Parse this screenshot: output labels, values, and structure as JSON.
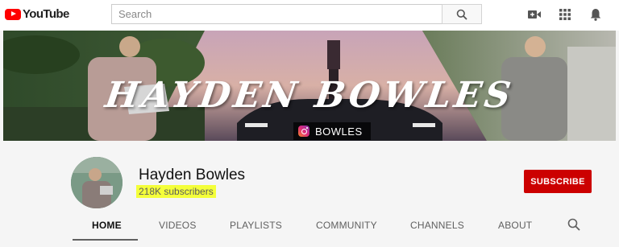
{
  "topbar": {
    "logo_text": "YouTube",
    "search_placeholder": "Search",
    "icons": [
      "create-video-icon",
      "apps-grid-icon",
      "notifications-bell-icon"
    ]
  },
  "banner": {
    "title": "HAYDEN BOWLES",
    "handle": "BOWLES",
    "handle_icon": "instagram-icon"
  },
  "channel": {
    "name": "Hayden Bowles",
    "subscribers": "218K subscribers",
    "subscribe_label": "SUBSCRIBE"
  },
  "tabs": [
    {
      "label": "HOME",
      "active": true
    },
    {
      "label": "VIDEOS"
    },
    {
      "label": "PLAYLISTS"
    },
    {
      "label": "COMMUNITY"
    },
    {
      "label": "CHANNELS"
    },
    {
      "label": "ABOUT"
    }
  ],
  "colors": {
    "brand_red": "#ff0000",
    "subscribe_red": "#cc0000",
    "highlight_yellow": "#f4ff3a"
  }
}
